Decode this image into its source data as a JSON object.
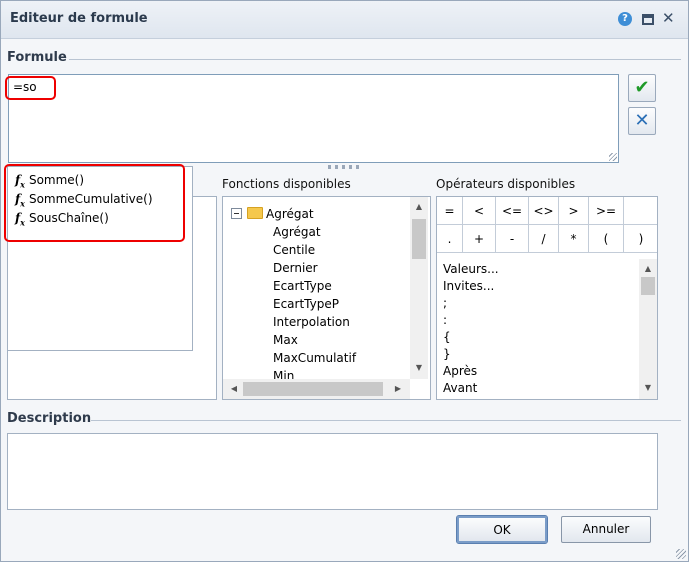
{
  "window": {
    "title": "Editeur de formule",
    "help_icon_glyph": "?",
    "close_icon_glyph": "✕"
  },
  "formula": {
    "section_label": "Formule",
    "value": "=so",
    "validate_icon": "✔",
    "clear_icon": "✕"
  },
  "autocomplete": {
    "icon_label": "f",
    "items": [
      "Somme()",
      "SommeCumulative()",
      "SousChaîne()"
    ]
  },
  "functions": {
    "label": "Fonctions disponibles",
    "root": "Agrégat",
    "items": [
      "Agrégat",
      "Centile",
      "Dernier",
      "EcartType",
      "EcartTypeP",
      "Interpolation",
      "Max",
      "MaxCumulatif",
      "Min"
    ]
  },
  "operators": {
    "label": "Opérateurs disponibles",
    "row1": [
      "=",
      "<",
      "<=",
      "<>",
      ">",
      ">="
    ],
    "row2": [
      ".",
      "+",
      "-",
      "/",
      "*",
      "(",
      ")"
    ],
    "list": [
      "Valeurs...",
      "Invites...",
      ";",
      ":",
      "{",
      "}",
      "Après",
      "Avant"
    ]
  },
  "description": {
    "section_label": "Description"
  },
  "buttons": {
    "ok": "OK",
    "cancel": "Annuler"
  },
  "colors": {
    "highlight": "#e00000",
    "accept": "#1f9a28",
    "clear": "#2b6fb6"
  }
}
